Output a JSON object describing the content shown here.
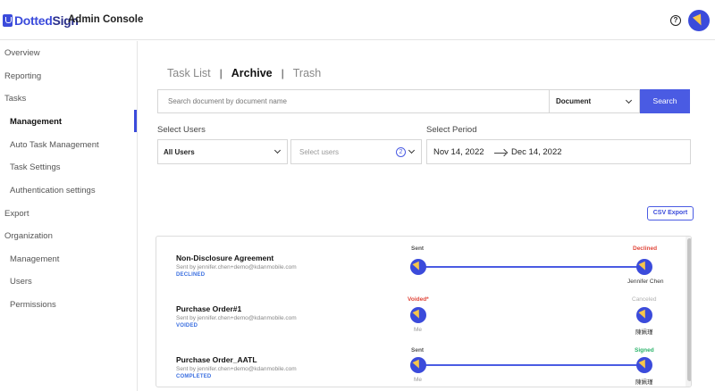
{
  "header": {
    "logo_prefix": "Dotted",
    "logo_suffix": "Sign",
    "title": "Admin Console",
    "help_icon": "question-circle-icon",
    "avatar_icon": "user-avatar-icon"
  },
  "sidebar": {
    "items": [
      {
        "label": "Overview"
      },
      {
        "label": "Reporting"
      },
      {
        "label": "Tasks"
      },
      {
        "label": "Management"
      },
      {
        "label": "Auto Task Management"
      },
      {
        "label": "Task Settings"
      },
      {
        "label": "Authentication settings"
      },
      {
        "label": "Export"
      },
      {
        "label": "Organization"
      },
      {
        "label": "Management"
      },
      {
        "label": "Users"
      },
      {
        "label": "Permissions"
      }
    ]
  },
  "tabs": [
    {
      "label": "Task List"
    },
    {
      "label": "Archive"
    },
    {
      "label": "Trash"
    }
  ],
  "tab_separator": "|",
  "search": {
    "placeholder": "Search document by document name",
    "type_value": "Document",
    "button_label": "Search"
  },
  "filters": {
    "users_label": "Select Users",
    "users_scope": "All Users",
    "users_placeholder": "Select users",
    "users_count": "2",
    "period_label": "Select Period",
    "period_start": "Nov 14, 2022",
    "period_end": "Dec 14, 2022"
  },
  "csv_export_label": "CSV Export",
  "documents": [
    {
      "name": "Non-Disclosure Agreement",
      "sender": "Sent by jennifer.chen+demo@kdanmobile.com",
      "status": "DECLINED",
      "start_label": "Sent",
      "start_name": "",
      "end_label": "Declined",
      "end_name": "Jennifer Chen"
    },
    {
      "name": "Purchase Order#1",
      "sender": "Sent by jennifer.chen+demo@kdanmobile.com",
      "status": "VOIDED",
      "start_label": "Voided*",
      "start_name": "Me",
      "end_label": "Canceled",
      "end_name": "陳姵瑾"
    },
    {
      "name": "Purchase Order_AATL",
      "sender": "Sent by jennifer.chen+demo@kdanmobile.com",
      "status": "COMPLETED",
      "start_label": "Sent",
      "start_name": "Me",
      "end_label": "Signed",
      "end_name": "陳姵瑾"
    }
  ],
  "colors": {
    "accent": "#4a5be3",
    "declined": "#e0463a",
    "voided": "#e0463a",
    "canceled": "#b0b0b0",
    "signed": "#2ab36a",
    "status_blue": "#3b6fe0"
  }
}
